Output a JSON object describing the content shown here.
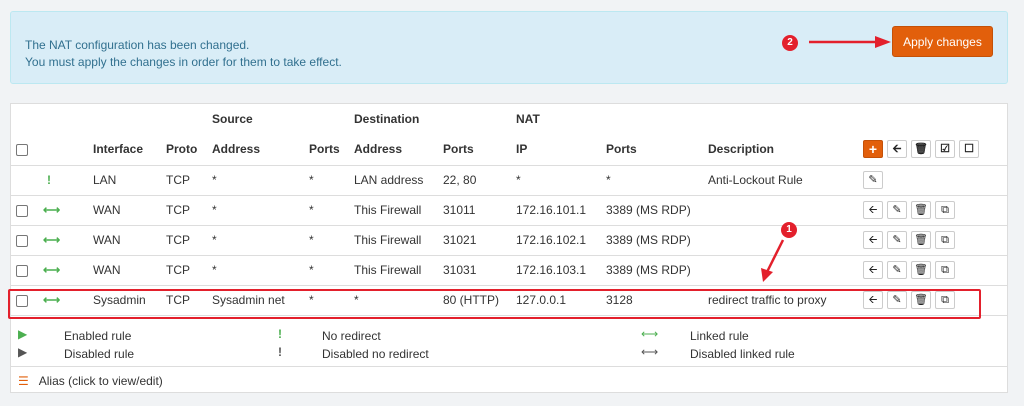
{
  "alert": {
    "line1": "The NAT configuration has been changed.",
    "line2": "You must apply the changes in order for them to take effect.",
    "apply_label": "Apply changes"
  },
  "annotations": {
    "badge1": "1",
    "badge2": "2"
  },
  "table": {
    "group_source": "Source",
    "group_destination": "Destination",
    "group_nat": "NAT",
    "columns": [
      "Interface",
      "Proto",
      "Address",
      "Ports",
      "Address",
      "Ports",
      "IP",
      "Ports",
      "Description"
    ],
    "rows": [
      {
        "interface": "LAN",
        "proto": "TCP",
        "src_addr": "*",
        "src_ports": "*",
        "dst_addr": "LAN address",
        "dst_ports": "22, 80",
        "nat_ip": "*",
        "nat_ports": "*",
        "description": "Anti-Lockout Rule"
      },
      {
        "interface": "WAN",
        "proto": "TCP",
        "src_addr": "*",
        "src_ports": "*",
        "dst_addr": "This Firewall",
        "dst_ports": "31011",
        "nat_ip": "172.16.101.1",
        "nat_ports": "3389 (MS RDP)",
        "description": ""
      },
      {
        "interface": "WAN",
        "proto": "TCP",
        "src_addr": "*",
        "src_ports": "*",
        "dst_addr": "This Firewall",
        "dst_ports": "31021",
        "nat_ip": "172.16.102.1",
        "nat_ports": "3389 (MS RDP)",
        "description": ""
      },
      {
        "interface": "WAN",
        "proto": "TCP",
        "src_addr": "*",
        "src_ports": "*",
        "dst_addr": "This Firewall",
        "dst_ports": "31031",
        "nat_ip": "172.16.103.1",
        "nat_ports": "3389 (MS RDP)",
        "description": ""
      },
      {
        "interface": "Sysadmin",
        "proto": "TCP",
        "src_addr": "Sysadmin net",
        "src_ports": "*",
        "dst_addr": "*",
        "dst_ports": "80 (HTTP)",
        "nat_ip": "127.0.0.1",
        "nat_ports": "3128",
        "description": "redirect traffic to proxy"
      }
    ]
  },
  "legend": {
    "enabled_rule": "Enabled rule",
    "disabled_rule": "Disabled rule",
    "no_redirect": "No redirect",
    "disabled_no_redirect": "Disabled no redirect",
    "linked_rule": "Linked rule",
    "disabled_linked_rule": "Disabled linked rule",
    "alias": "Alias (click to view/edit)"
  },
  "colors": {
    "accent": "#e25f0b",
    "annotation": "#e3202c",
    "enabled": "#4caf50"
  }
}
